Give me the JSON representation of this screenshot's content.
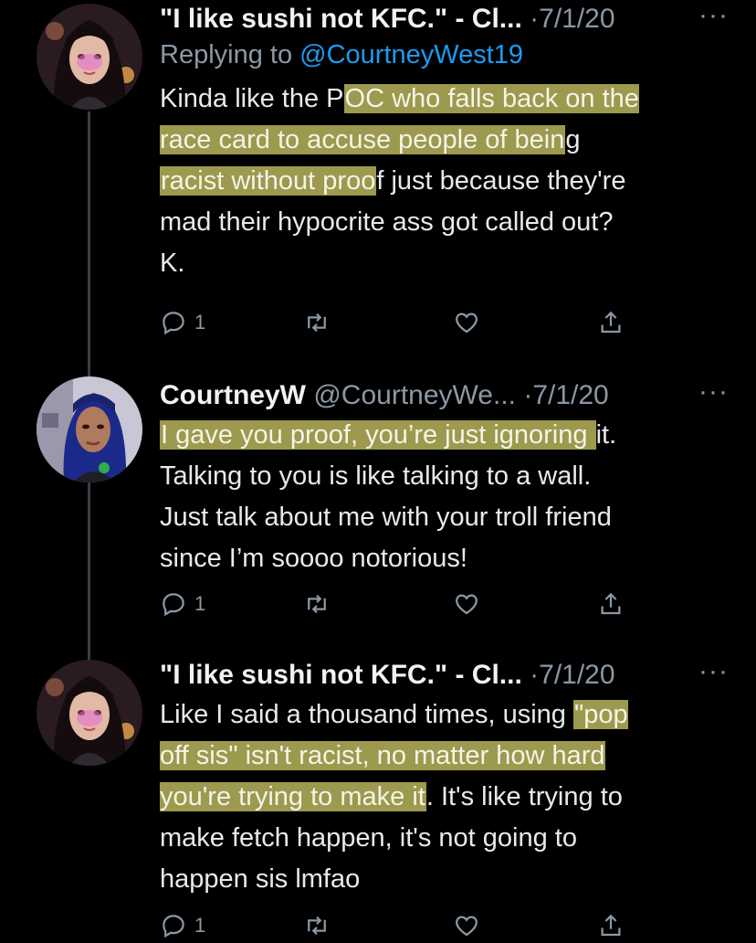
{
  "tweets": [
    {
      "name": "\"I like sushi not KFC.\" - Cl...",
      "handle": "",
      "date": "·7/1/20",
      "more": "···",
      "replying_prefix": "Replying to ",
      "replying_mention": "@CourtneyWest19",
      "body_segments": [
        {
          "text": "Kinda like the P",
          "highlight": false
        },
        {
          "text": "OC who falls back on the\nrace card to accuse people of bein",
          "highlight": true
        },
        {
          "text": "g\n",
          "highlight": false
        },
        {
          "text": "racist without proo",
          "highlight": true
        },
        {
          "text": "f just because they're\nmad their hypocrite ass got called out?\nK.",
          "highlight": false
        }
      ],
      "reply_count": "1",
      "avatar_icon": "anime-girl-avatar"
    },
    {
      "name": "CourtneyW",
      "handle": "@CourtneyWe...",
      "date": "·7/1/20",
      "more": "···",
      "body_segments": [
        {
          "text": "I gave you proof, you’re just ignoring ",
          "highlight": true
        },
        {
          "text": "it.\nTalking to you is like talking to a wall.\nJust talk about me with your troll friend\nsince I’m soooo notorious!",
          "highlight": false
        }
      ],
      "reply_count": "1",
      "avatar_icon": "woman-blue-hair-avatar"
    },
    {
      "name": "\"I like sushi not KFC.\" - Cl...",
      "handle": "",
      "date": "·7/1/20",
      "more": "···",
      "body_segments": [
        {
          "text": "Like I said a thousand times, using ",
          "highlight": false
        },
        {
          "text": "\"pop\noff sis\" isn't racist, no matter how hard\nyou're trying to make it",
          "highlight": true
        },
        {
          "text": ". It's like trying to\nmake fetch happen, it's not going to\nhappen sis lmfao",
          "highlight": false
        }
      ],
      "reply_count": "1",
      "avatar_icon": "anime-girl-avatar"
    }
  ],
  "colors": {
    "background": "#000000",
    "text": "#e7e9ea",
    "muted": "#8b98a5",
    "link": "#1d9bf0",
    "highlight": "#dad46c"
  }
}
